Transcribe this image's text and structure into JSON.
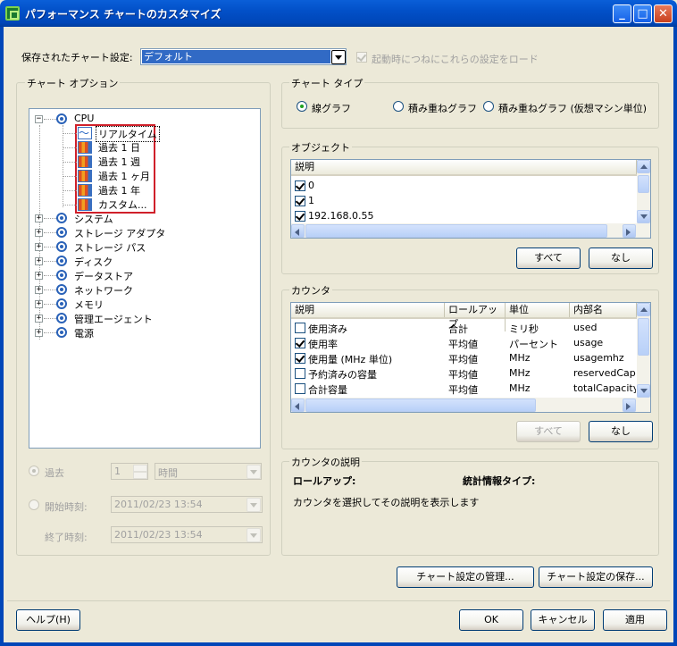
{
  "window": {
    "title": "パフォーマンス チャートのカスタマイズ",
    "minimize": "_",
    "maximize": "□",
    "close": "✕"
  },
  "saved_settings": {
    "label": "保存されたチャート設定:",
    "value": "デフォルト",
    "load_on_startup_label": "起動時につねにこれらの設定をロード",
    "load_on_startup_checked": true
  },
  "chart_options": {
    "legend": "チャート オプション",
    "tree": [
      {
        "label": "CPU",
        "expanded": true,
        "children": [
          "リアルタイム",
          "過去 1 日",
          "過去 1 週",
          "過去 1 ヶ月",
          "過去 1 年",
          "カスタム..."
        ]
      },
      {
        "label": "システム"
      },
      {
        "label": "ストレージ アダプタ"
      },
      {
        "label": "ストレージ パス"
      },
      {
        "label": "ディスク"
      },
      {
        "label": "データストア"
      },
      {
        "label": "ネットワーク"
      },
      {
        "label": "メモリ"
      },
      {
        "label": "管理エージェント"
      },
      {
        "label": "電源"
      }
    ],
    "last_label": "過去",
    "last_value": "1",
    "last_unit": "時間",
    "start_label": "開始時刻:",
    "start_value": "2011/02/23 13:54",
    "end_label": "終了時刻:",
    "end_value": "2011/02/23 13:54"
  },
  "chart_type": {
    "legend": "チャート タイプ",
    "options": [
      "線グラフ",
      "積み重ねグラフ",
      "積み重ねグラフ (仮想マシン単位)"
    ],
    "selected": 0
  },
  "objects": {
    "legend": "オブジェクト",
    "column": "説明",
    "rows": [
      {
        "label": "0",
        "checked": true
      },
      {
        "label": "1",
        "checked": true
      },
      {
        "label": "192.168.0.55",
        "checked": true
      }
    ],
    "all_button": "すべて",
    "none_button": "なし"
  },
  "counters": {
    "legend": "カウンタ",
    "columns": [
      "説明",
      "ロールアップ",
      "単位",
      "内部名"
    ],
    "rows": [
      {
        "desc": "使用済み",
        "rollup": "合計",
        "unit": "ミリ秒",
        "internal": "used",
        "checked": false
      },
      {
        "desc": "使用率",
        "rollup": "平均値",
        "unit": "パーセント",
        "internal": "usage",
        "checked": true
      },
      {
        "desc": "使用量 (MHz 単位)",
        "rollup": "平均値",
        "unit": "MHz",
        "internal": "usagemhz",
        "checked": true
      },
      {
        "desc": "予約済みの容量",
        "rollup": "平均値",
        "unit": "MHz",
        "internal": "reservedCapa",
        "checked": false
      },
      {
        "desc": "合計容量",
        "rollup": "平均値",
        "unit": "MHz",
        "internal": "totalCapacity",
        "checked": false
      }
    ],
    "all_button": "すべて",
    "none_button": "なし"
  },
  "counter_desc": {
    "legend": "カウンタの説明",
    "rollup_label": "ロールアップ:",
    "stat_type_label": "統計情報タイプ:",
    "hint": "カウンタを選択してその説明を表示します"
  },
  "buttons": {
    "manage": "チャート設定の管理...",
    "save": "チャート設定の保存...",
    "help": "ヘルプ(H)",
    "ok": "OK",
    "cancel": "キャンセル",
    "apply": "適用"
  }
}
